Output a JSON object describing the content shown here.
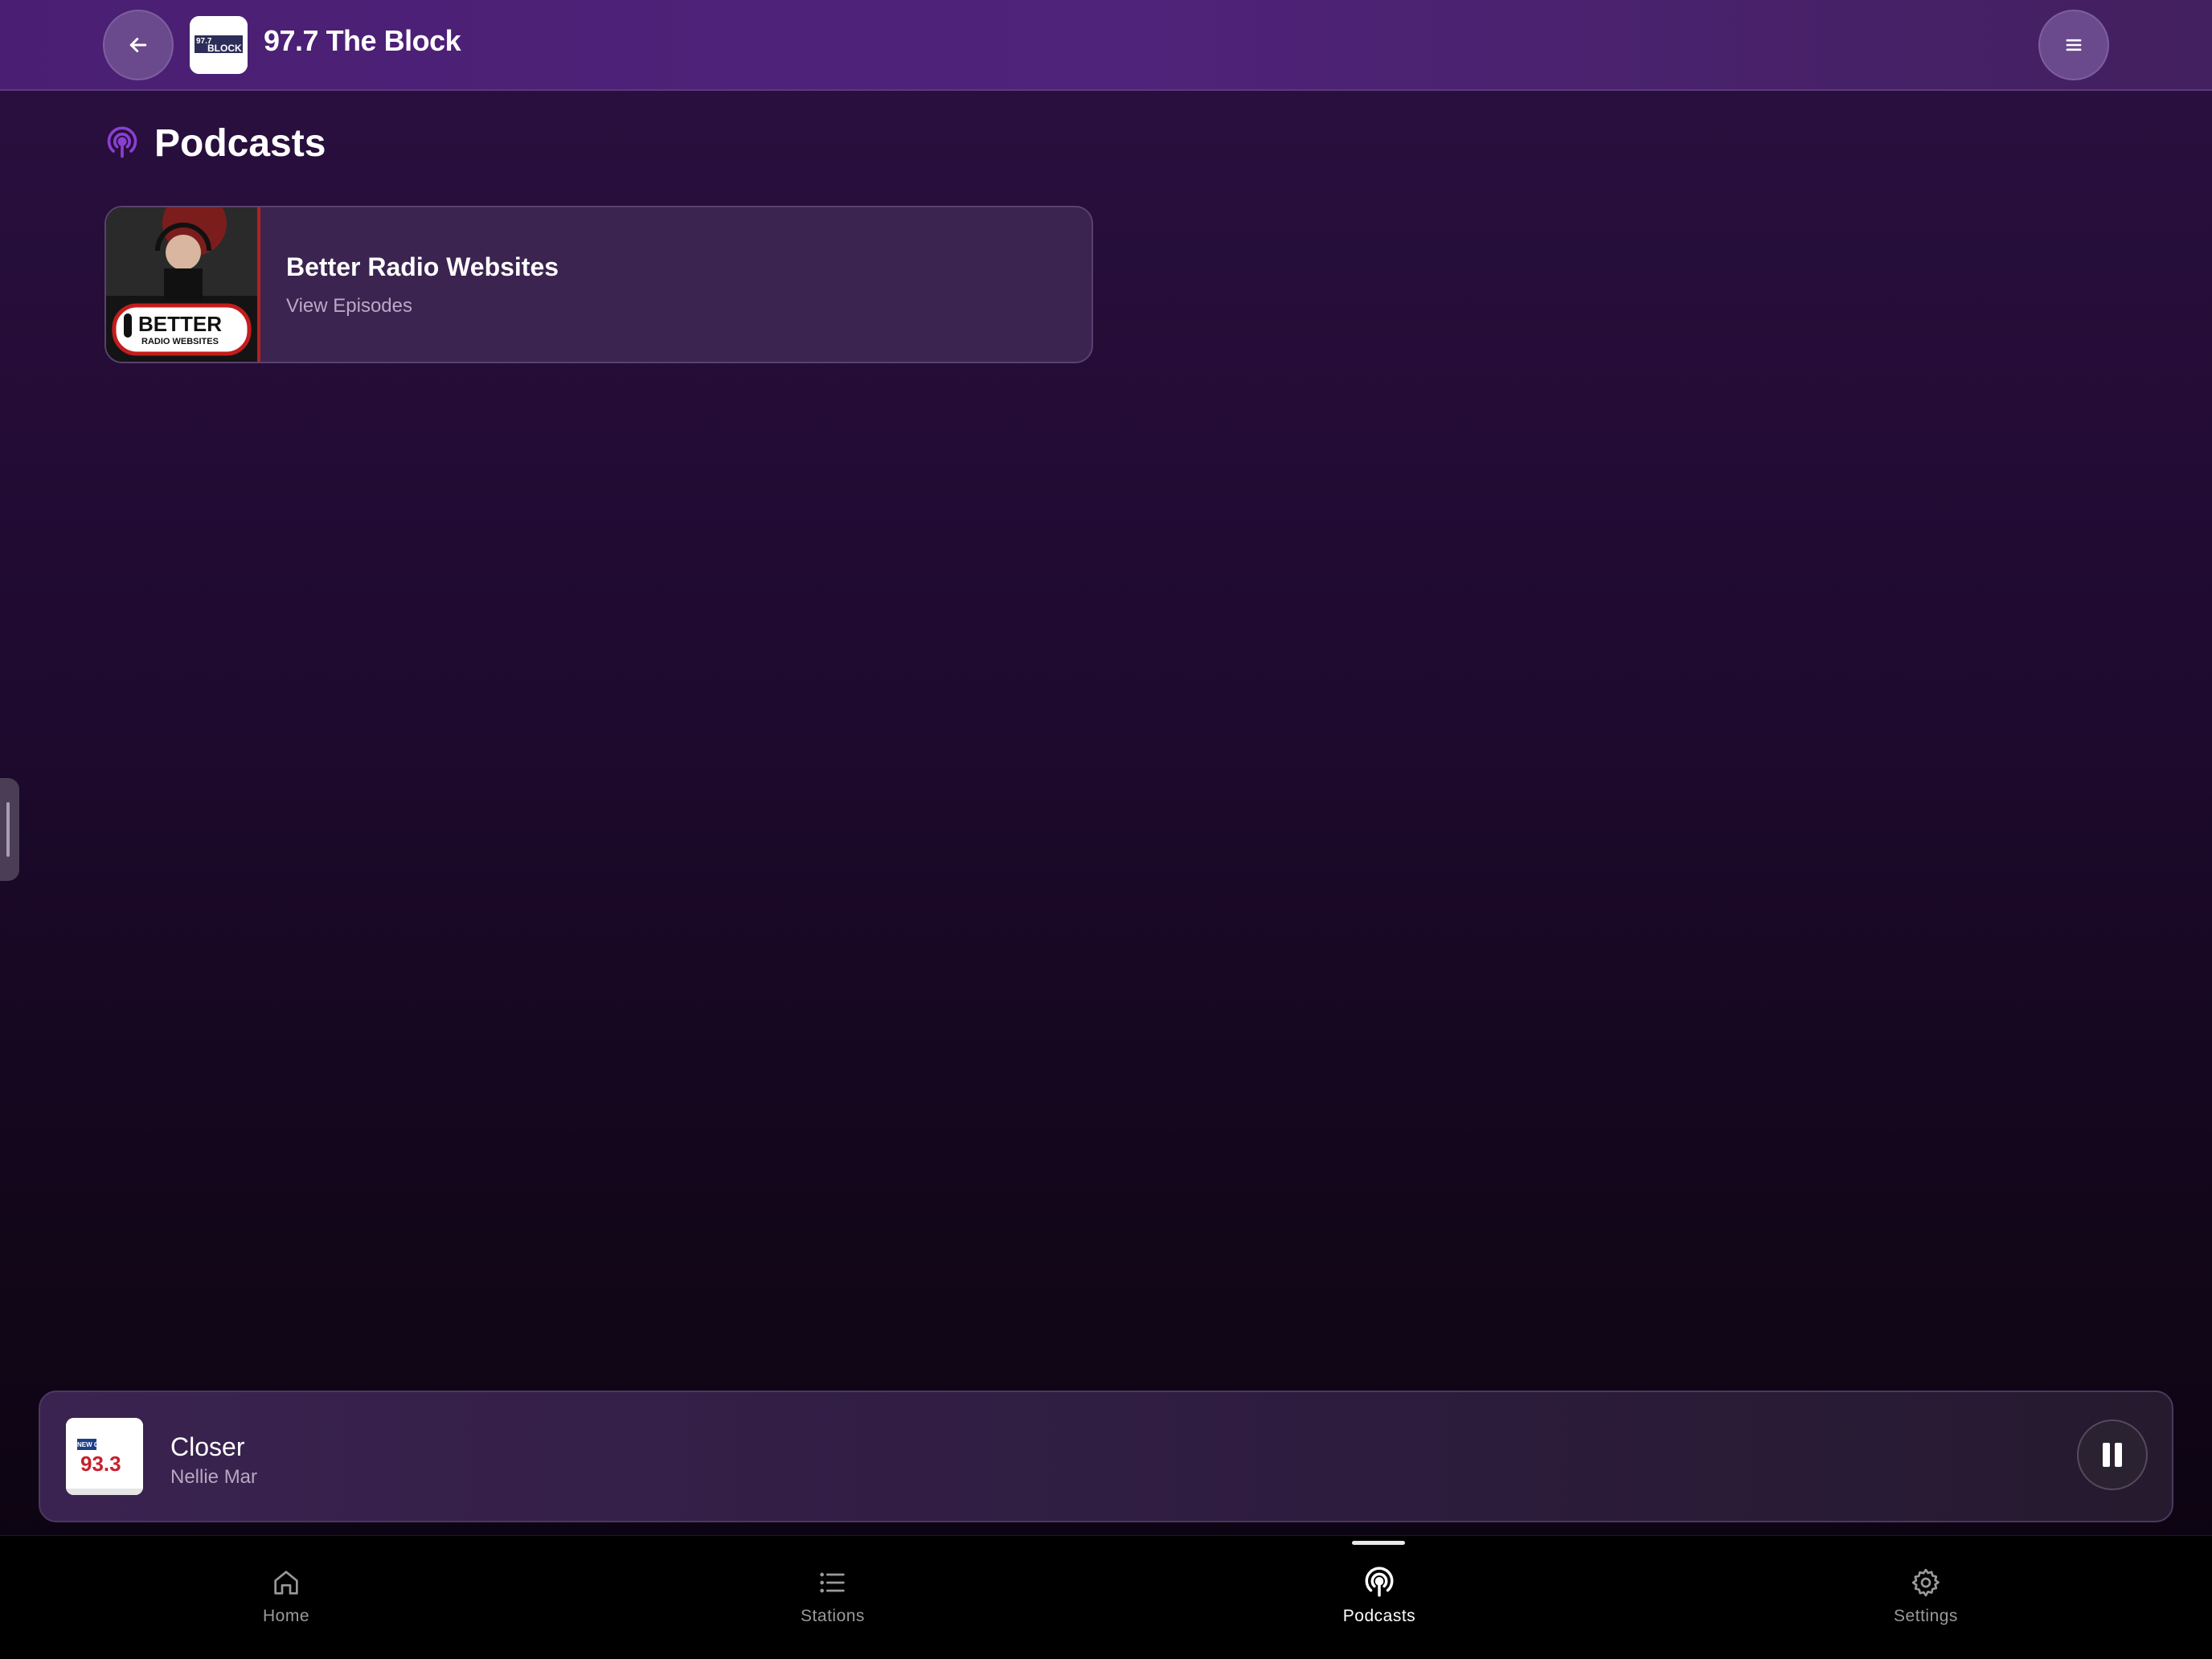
{
  "header": {
    "title": "97.7 The Block",
    "logo_text_top": "97.7",
    "logo_text_bottom": "BLOCK"
  },
  "page": {
    "title": "Podcasts",
    "accent_color": "#8a3fd1"
  },
  "podcasts": [
    {
      "name": "Better Radio Websites",
      "subtitle": "View Episodes",
      "art_text_main": "BETTER",
      "art_text_sub": "RADIO WEBSITES"
    }
  ],
  "now_playing": {
    "title": "Closer",
    "artist": "Nellie Mar",
    "art_text_top": "NEW COUNTRY",
    "art_text_main": "93.3",
    "state": "playing"
  },
  "bottom_nav": {
    "items": [
      {
        "label": "Home",
        "icon": "home-icon",
        "active": false
      },
      {
        "label": "Stations",
        "icon": "list-icon",
        "active": false
      },
      {
        "label": "Podcasts",
        "icon": "podcast-icon",
        "active": true
      },
      {
        "label": "Settings",
        "icon": "gear-icon",
        "active": false
      }
    ]
  }
}
